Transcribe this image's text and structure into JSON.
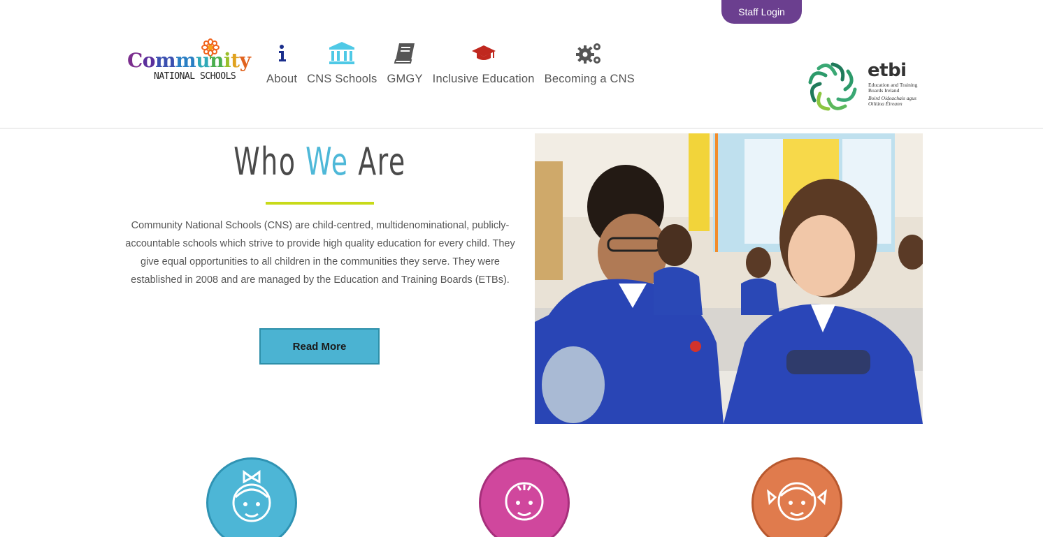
{
  "staff_login": "Staff Login",
  "logo": {
    "word": "Community",
    "sub": "NATIONAL SCHOOLS"
  },
  "nav": [
    {
      "label": "About",
      "icon": "info-icon",
      "color": "#1a2e8c"
    },
    {
      "label": "CNS Schools",
      "icon": "institution-icon",
      "color": "#4fc9e6"
    },
    {
      "label": "GMGY",
      "icon": "book-icon",
      "color": "#555555"
    },
    {
      "label": "Inclusive Education",
      "icon": "graduation-cap-icon",
      "color": "#c0281f"
    },
    {
      "label": "Becoming a CNS",
      "icon": "gears-icon",
      "color": "#555555"
    }
  ],
  "etbi": {
    "name": "etbi",
    "english": "Education and Training Boards Ireland",
    "irish": "Boird Oideachais agus Oiliúna Éireann"
  },
  "who_we_are": {
    "title_part1": "Who ",
    "title_accent": "We",
    "title_part2": " Are",
    "body": "Community National Schools (CNS) are child-centred, multidenominational, publicly-accountable schools which strive to provide high quality education for every child. They give equal opportunities to all children in the communities they serve. They were established in 2008 and are managed by the Education and Training Boards (ETBs).",
    "button": "Read More"
  },
  "colors": {
    "purple": "#6b3f8f",
    "blue": "#4db6d6",
    "pink": "#d0479d",
    "orange": "#e07b4d",
    "lime": "#c8da19"
  },
  "circles": [
    {
      "icon": "girl-with-bow-icon"
    },
    {
      "icon": "boy-face-icon"
    },
    {
      "icon": "girl-with-pigtails-icon"
    }
  ]
}
